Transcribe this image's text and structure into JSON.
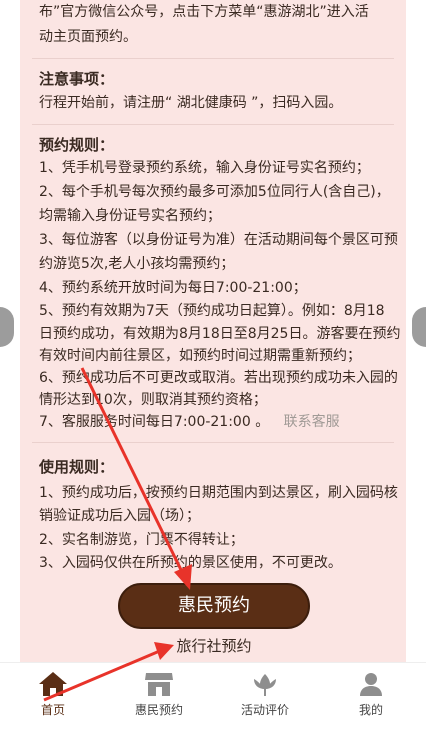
{
  "intro": {
    "line1": "布”官方微信公众号，点击下方菜单“惠游湖北”进入活",
    "line2": "动主页面预约。"
  },
  "notice": {
    "heading": "注意事项：",
    "line1": "行程开始前，请注册“ 湖北健康码 ”，扫码入园。"
  },
  "booking_rules": {
    "heading": "预约规则：",
    "lines": [
      "1、凭手机号登录预约系统，输入身份证号实名预约；",
      "2、每个手机号每次预约最多可添加5位同行人(含自己)，",
      "均需输入身份证号实名预约；",
      "3、每位游客（以身份证号为准）在活动期间每个景区可预",
      "约游览5次,老人小孩均需预约；",
      "4、预约系统开放时间为每日7:00-21:00；",
      "5、预约有效期为7天（预约成功日起算）。例如：8月18",
      "日预约成功，有效期为8月18日至8月25日。游客要在预约",
      "有效时间内前往景区，如预约时间过期需重新预约；",
      "6、预约成功后不可更改或取消。若出现预约成功未入园的",
      "情形达到10次，则取消其预约资格；"
    ],
    "service_line": "7、客服服务时间每日7:00-21:00 。",
    "contact_label": "联系客服"
  },
  "usage_rules": {
    "heading": "使用规则：",
    "lines": [
      "1、预约成功后，按预约日期范围内到达景区，刷入园码核",
      "销验证成功后入园（场）；",
      "2、实名制游览，门票不得转让；",
      "3、入园码仅供在所预约的景区使用，不可更改。"
    ]
  },
  "buttons": {
    "primary": "惠民预约",
    "agency": "旅行社预约"
  },
  "tabbar": {
    "items": [
      {
        "label": "首页",
        "icon": "home-icon"
      },
      {
        "label": "惠民预约",
        "icon": "shop-icon"
      },
      {
        "label": "活动评价",
        "icon": "flower-icon"
      },
      {
        "label": "我的",
        "icon": "user-icon"
      }
    ]
  },
  "colors": {
    "card_background": "#fbe5e3",
    "button_brown": "#5a2e15",
    "annotation_red": "#e8332a"
  }
}
